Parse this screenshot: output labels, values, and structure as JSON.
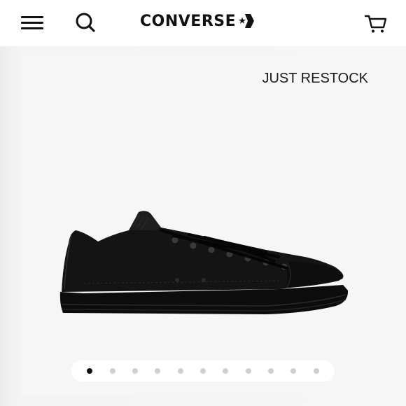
{
  "header": {
    "logo_text": "CONVERSE",
    "menu_icon": "hamburger-menu-icon",
    "search_icon": "search-icon",
    "cart_icon": "cart-icon",
    "logo_icon": "star-chevron-icon"
  },
  "product": {
    "badge": "JUST RESTOCK",
    "image": "black-leather-low-top-sneaker"
  },
  "carousel": {
    "total_slides": 11,
    "active_index": 0
  },
  "colors": {
    "text": "#111111",
    "background": "#f6f6f6",
    "dot_inactive": "#cfcfcf",
    "dot_active": "#111111"
  }
}
